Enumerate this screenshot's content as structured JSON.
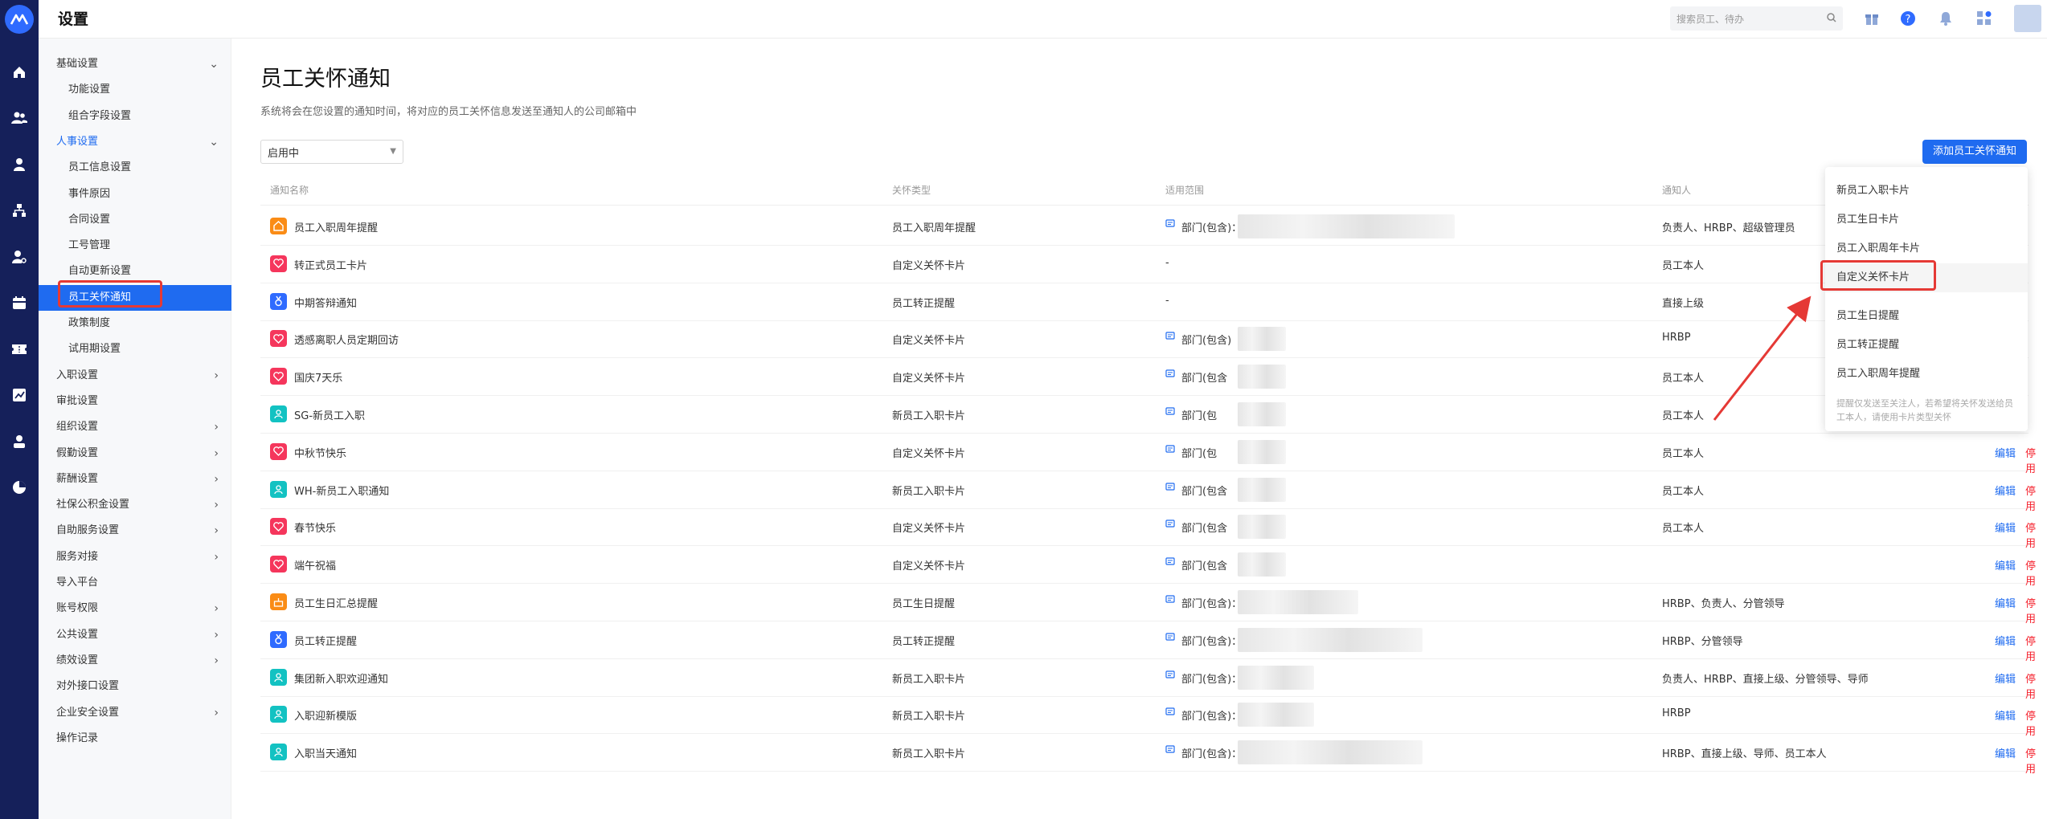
{
  "header": {
    "title": "设置",
    "search_placeholder": "搜索员工、待办"
  },
  "sidebar": {
    "items": [
      {
        "label": "基础设置",
        "level": 1,
        "expand": "down"
      },
      {
        "label": "功能设置",
        "level": 2
      },
      {
        "label": "组合字段设置",
        "level": 2
      },
      {
        "label": "人事设置",
        "level": 1,
        "expand": "down",
        "highlight": true
      },
      {
        "label": "员工信息设置",
        "level": 2
      },
      {
        "label": "事件原因",
        "level": 2
      },
      {
        "label": "合同设置",
        "level": 2
      },
      {
        "label": "工号管理",
        "level": 2
      },
      {
        "label": "自动更新设置",
        "level": 2
      },
      {
        "label": "员工关怀通知",
        "level": 2,
        "active": true
      },
      {
        "label": "政策制度",
        "level": 2
      },
      {
        "label": "试用期设置",
        "level": 2
      },
      {
        "label": "入职设置",
        "level": 1,
        "expand": "right"
      },
      {
        "label": "审批设置",
        "level": 1
      },
      {
        "label": "组织设置",
        "level": 1,
        "expand": "right"
      },
      {
        "label": "假勤设置",
        "level": 1,
        "expand": "right"
      },
      {
        "label": "薪酬设置",
        "level": 1,
        "expand": "right"
      },
      {
        "label": "社保公积金设置",
        "level": 1,
        "expand": "right"
      },
      {
        "label": "自助服务设置",
        "level": 1,
        "expand": "right"
      },
      {
        "label": "服务对接",
        "level": 1,
        "expand": "right"
      },
      {
        "label": "导入平台",
        "level": 1
      },
      {
        "label": "账号权限",
        "level": 1,
        "expand": "right"
      },
      {
        "label": "公共设置",
        "level": 1,
        "expand": "right"
      },
      {
        "label": "绩效设置",
        "level": 1,
        "expand": "right"
      },
      {
        "label": "对外接口设置",
        "level": 1
      },
      {
        "label": "企业安全设置",
        "level": 1,
        "expand": "right"
      },
      {
        "label": "操作记录",
        "level": 1
      }
    ]
  },
  "main": {
    "title": "员工关怀通知",
    "description": "系统将会在您设置的通知时间，将对应的员工关怀信息发送至通知人的公司邮箱中",
    "filter": {
      "selected": "启用中"
    },
    "add_button": "添加员工关怀通知",
    "columns": [
      "通知名称",
      "关怀类型",
      "适用范围",
      "通知人"
    ],
    "edit_label": "编辑",
    "disable_label": "停用",
    "rows": [
      {
        "name": "员工入职周年提醒",
        "type": "员工入职周年提醒",
        "scope": "部门(包含)：",
        "notifier": "负责人、HRBP、超级管理员",
        "icon": "house-icon",
        "color": "#fa8c16"
      },
      {
        "name": "转正式员工卡片",
        "type": "自定义关怀卡片",
        "scope": "-",
        "notifier": "员工本人",
        "icon": "heart-icon",
        "color": "#f5365c"
      },
      {
        "name": "中期答辩通知",
        "type": "员工转正提醒",
        "scope": "-",
        "notifier": "直接上级",
        "icon": "medal-icon",
        "color": "#2f6bff"
      },
      {
        "name": "透感离职人员定期回访",
        "type": "自定义关怀卡片",
        "scope": "部门(包含)",
        "notifier": "HRBP",
        "icon": "heart-icon",
        "color": "#f5365c"
      },
      {
        "name": "国庆7天乐",
        "type": "自定义关怀卡片",
        "scope": "部门(包含",
        "notifier": "员工本人",
        "icon": "heart-icon",
        "color": "#f5365c"
      },
      {
        "name": "SG-新员工入职",
        "type": "新员工入职卡片",
        "scope": "部门(包",
        "notifier": "员工本人",
        "icon": "user-icon",
        "color": "#13c2c2"
      },
      {
        "name": "中秋节快乐",
        "type": "自定义关怀卡片",
        "scope": "部门(包",
        "notifier": "员工本人",
        "icon": "heart-icon",
        "color": "#f5365c"
      },
      {
        "name": "WH-新员工入职通知",
        "type": "新员工入职卡片",
        "scope": "部门(包含",
        "notifier": "员工本人",
        "icon": "user-icon",
        "color": "#13c2c2"
      },
      {
        "name": "春节快乐",
        "type": "自定义关怀卡片",
        "scope": "部门(包含",
        "notifier": "员工本人",
        "icon": "heart-icon",
        "color": "#f5365c"
      },
      {
        "name": "端午祝福",
        "type": "自定义关怀卡片",
        "scope": "部门(包含",
        "notifier": "",
        "icon": "heart-icon",
        "color": "#f5365c"
      },
      {
        "name": "员工生日汇总提醒",
        "type": "员工生日提醒",
        "scope": "部门(包含)：",
        "notifier": "HRBP、负责人、分管领导",
        "icon": "cake-icon",
        "color": "#fa8c16"
      },
      {
        "name": "员工转正提醒",
        "type": "员工转正提醒",
        "scope": "部门(包含)：",
        "notifier": "HRBP、分管领导",
        "icon": "medal-icon",
        "color": "#2f6bff"
      },
      {
        "name": "集团新入职欢迎通知",
        "type": "新员工入职卡片",
        "scope": "部门(包含)：",
        "notifier": "负责人、HRBP、直接上级、分管领导、导师",
        "icon": "user-icon",
        "color": "#13c2c2"
      },
      {
        "name": "入职迎新模版",
        "type": "新员工入职卡片",
        "scope": "部门(包含)：",
        "notifier": "HRBP",
        "icon": "user-icon",
        "color": "#13c2c2"
      },
      {
        "name": "入职当天通知",
        "type": "新员工入职卡片",
        "scope": "部门(包含)：",
        "notifier": "HRBP、直接上级、导师、员工本人",
        "icon": "user-icon",
        "color": "#13c2c2"
      }
    ]
  },
  "dropdown": {
    "items": [
      "新员工入职卡片",
      "员工生日卡片",
      "员工入职周年卡片",
      "自定义关怀卡片",
      "员工生日提醒",
      "员工转正提醒",
      "员工入职周年提醒"
    ],
    "note": "提醒仅发送至关注人，若希望将关怀发送给员工本人，请使用卡片类型关怀"
  },
  "colors": {
    "primary": "#1f6bf0",
    "rail": "#15205a",
    "danger": "#f5222d",
    "highlight_box": "#e53935"
  }
}
